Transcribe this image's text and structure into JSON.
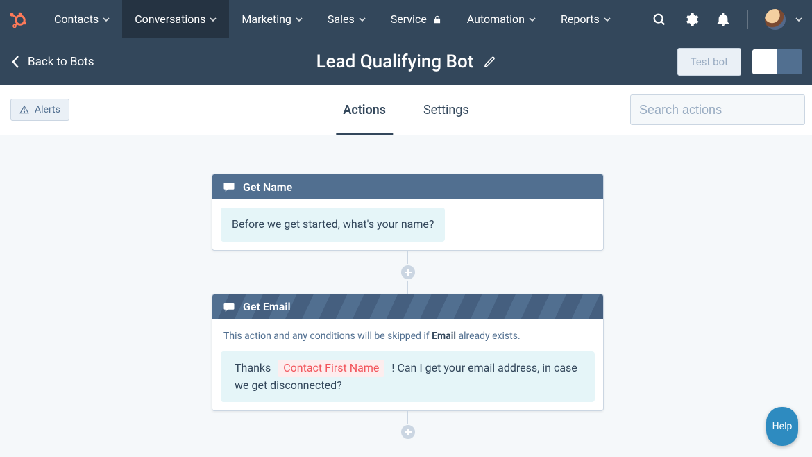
{
  "nav": {
    "items": [
      {
        "label": "Contacts",
        "active": false,
        "lock": false,
        "chev": true
      },
      {
        "label": "Conversations",
        "active": true,
        "lock": false,
        "chev": true
      },
      {
        "label": "Marketing",
        "active": false,
        "lock": false,
        "chev": true
      },
      {
        "label": "Sales",
        "active": false,
        "lock": false,
        "chev": true
      },
      {
        "label": "Service",
        "active": false,
        "lock": true,
        "chev": false
      },
      {
        "label": "Automation",
        "active": false,
        "lock": false,
        "chev": true
      },
      {
        "label": "Reports",
        "active": false,
        "lock": false,
        "chev": true
      }
    ]
  },
  "subheader": {
    "back_label": "Back to Bots",
    "title": "Lead Qualifying Bot",
    "test_bot_label": "Test bot"
  },
  "toolbar": {
    "alerts_label": "Alerts",
    "tabs": [
      {
        "label": "Actions",
        "active": true
      },
      {
        "label": "Settings",
        "active": false
      }
    ],
    "search_placeholder": "Search actions"
  },
  "flow": {
    "cards": [
      {
        "title": "Get Name",
        "striped": false,
        "note_prefix": null,
        "note_strong": null,
        "note_suffix": null,
        "message_pre": "Before we get started, what's your name?",
        "token": null,
        "message_post": null
      },
      {
        "title": "Get Email",
        "striped": true,
        "note_prefix": "This action and any conditions will be skipped if ",
        "note_strong": "Email",
        "note_suffix": " already exists.",
        "message_pre": "Thanks ",
        "token": "Contact First Name",
        "message_post": " ! Can I get your email address, in case we get disconnected?"
      }
    ]
  },
  "help": {
    "label": "Help"
  }
}
